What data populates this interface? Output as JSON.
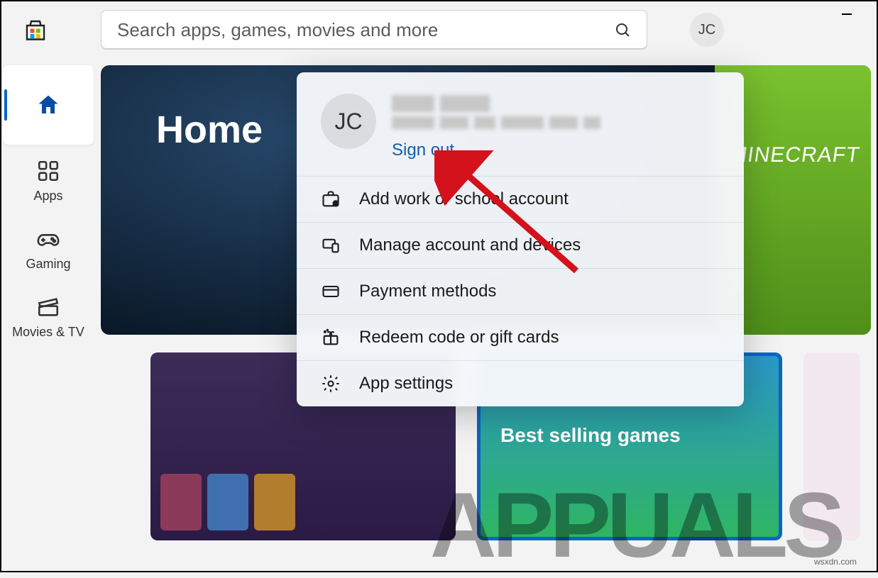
{
  "window": {
    "minimize": "–"
  },
  "search": {
    "placeholder": "Search apps, games, movies and more"
  },
  "user": {
    "initials": "JC"
  },
  "nav": {
    "home": {
      "label": ""
    },
    "apps": {
      "label": "Apps"
    },
    "gaming": {
      "label": "Gaming"
    },
    "movies": {
      "label": "Movies & TV"
    }
  },
  "hero": {
    "title": "Home",
    "rightPanel": "MINECRAFT"
  },
  "cards": {
    "games": {
      "label": "Best selling games"
    }
  },
  "flyout": {
    "initials": "JC",
    "signout": "Sign out",
    "items": {
      "addwork": "Add work or school account",
      "manage": "Manage account and devices",
      "payment": "Payment methods",
      "redeem": "Redeem code or gift cards",
      "settings": "App settings"
    }
  },
  "watermark": {
    "text": "APPUALS",
    "small": "wsxdn.com"
  }
}
